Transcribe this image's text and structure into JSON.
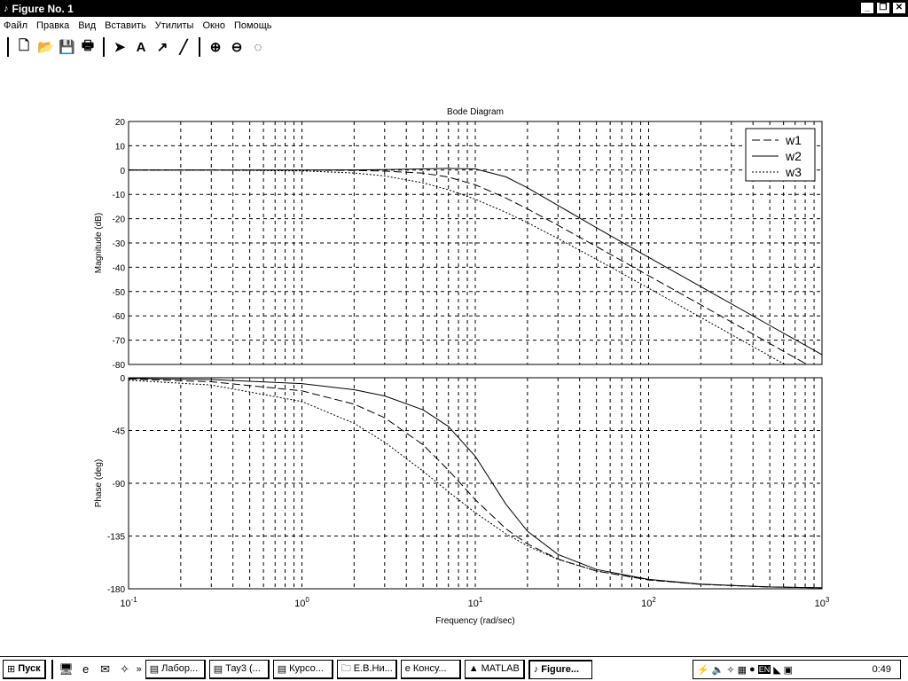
{
  "window": {
    "title": "Figure No. 1",
    "icon": "matlab-figure-icon"
  },
  "menu": [
    "Файл",
    "Правка",
    "Вид",
    "Вставить",
    "Утилиты",
    "Окно",
    "Помощь"
  ],
  "toolbar": [
    {
      "name": "new-icon",
      "glyph": "🗋"
    },
    {
      "name": "open-icon",
      "glyph": "📂"
    },
    {
      "name": "save-icon",
      "glyph": "💾"
    },
    {
      "name": "print-icon",
      "glyph": "🖶"
    },
    {
      "name": "sep"
    },
    {
      "name": "select-arrow-icon",
      "glyph": "➤"
    },
    {
      "name": "text-icon",
      "glyph": "A"
    },
    {
      "name": "arrow-icon",
      "glyph": "↗"
    },
    {
      "name": "line-icon",
      "glyph": "╱"
    },
    {
      "name": "sep"
    },
    {
      "name": "zoom-in-icon",
      "glyph": "⊕"
    },
    {
      "name": "zoom-out-icon",
      "glyph": "⊖"
    },
    {
      "name": "rotate-icon",
      "glyph": "◌"
    }
  ],
  "chart_data": {
    "type": "line",
    "title": "Bode Diagram",
    "xlabel": "Frequency  (rad/sec)",
    "xscale": "log",
    "xlim": [
      0.1,
      1000
    ],
    "xticks": [
      {
        "base": "10",
        "exp": "-1",
        "v": 0.1
      },
      {
        "base": "10",
        "exp": "0",
        "v": 1
      },
      {
        "base": "10",
        "exp": "1",
        "v": 10
      },
      {
        "base": "10",
        "exp": "2",
        "v": 100
      },
      {
        "base": "10",
        "exp": "3",
        "v": 1000
      }
    ],
    "grid": true,
    "legend": {
      "position": "top-right",
      "entries": [
        "w1",
        "w2",
        "w3"
      ]
    },
    "x": [
      0.1,
      0.3,
      1,
      2,
      3,
      5,
      7,
      10,
      15,
      20,
      30,
      50,
      100,
      200,
      500,
      1000
    ],
    "magnitude": {
      "ylabel": "Magnitude (dB)",
      "ylim": [
        -80,
        20
      ],
      "yticks": [
        20,
        10,
        0,
        -10,
        -20,
        -30,
        -40,
        -50,
        -60,
        -70,
        -80
      ],
      "series": [
        {
          "name": "w1",
          "style": "dashed",
          "values": [
            0,
            0,
            -0.04,
            -0.16,
            -0.39,
            -1.29,
            -2.88,
            -6.07,
            -11.48,
            -15.99,
            -22.74,
            -31.47,
            -43.46,
            -55.49,
            -71.4,
            -83.45
          ]
        },
        {
          "name": "w2",
          "style": "solid",
          "values": [
            0,
            0,
            0.02,
            0.08,
            0.18,
            0.46,
            0.7,
            0.46,
            -2.76,
            -7.29,
            -14.57,
            -23.74,
            -35.93,
            -48.01,
            -63.94,
            -75.99
          ]
        },
        {
          "name": "w3",
          "style": "dotted",
          "values": [
            -0.01,
            -0.03,
            -0.32,
            -1.2,
            -2.42,
            -5.26,
            -8.11,
            -12.0,
            -17.38,
            -21.68,
            -28.16,
            -36.73,
            -48.63,
            -60.64,
            -76.55,
            -88.6
          ]
        }
      ]
    },
    "phase": {
      "ylabel": "Phase (deg)",
      "ylim": [
        -180,
        0
      ],
      "yticks": [
        0,
        -45,
        -90,
        -135,
        -180
      ],
      "series": [
        {
          "name": "w1",
          "style": "dashed",
          "values": [
            -1.1,
            -3.4,
            -11.2,
            -22.5,
            -34.1,
            -57.2,
            -78.8,
            -104,
            -128.7,
            -141.7,
            -154.7,
            -164.9,
            -172.5,
            -176.2,
            -178.5,
            -179.2
          ]
        },
        {
          "name": "w2",
          "style": "solid",
          "values": [
            -0.5,
            -1.5,
            -5.0,
            -10.2,
            -15.5,
            -27.4,
            -41.5,
            -67.0,
            -107.7,
            -131,
            -150.7,
            -163.5,
            -172,
            -176,
            -178.4,
            -179.2
          ]
        },
        {
          "name": "w3",
          "style": "dotted",
          "values": [
            -2.1,
            -6.2,
            -20.3,
            -38.9,
            -55.0,
            -79.7,
            -97.2,
            -115.1,
            -133,
            -143.5,
            -155,
            -164.8,
            -172.3,
            -176.2,
            -178.5,
            -179.2
          ]
        }
      ]
    }
  },
  "taskbar": {
    "start": "Пуск",
    "quicklaunch": [
      "desktop-icon",
      "ie-icon",
      "outlook-icon",
      "channels-icon"
    ],
    "more": "»",
    "buttons": [
      "Лабор...",
      "Тау3 (...",
      "Курсо...",
      "Е.В.Ни...",
      "Консу...",
      "MATLAB",
      "Figure..."
    ],
    "active": 6,
    "clock": "0:49",
    "tray_lang": "EN"
  }
}
